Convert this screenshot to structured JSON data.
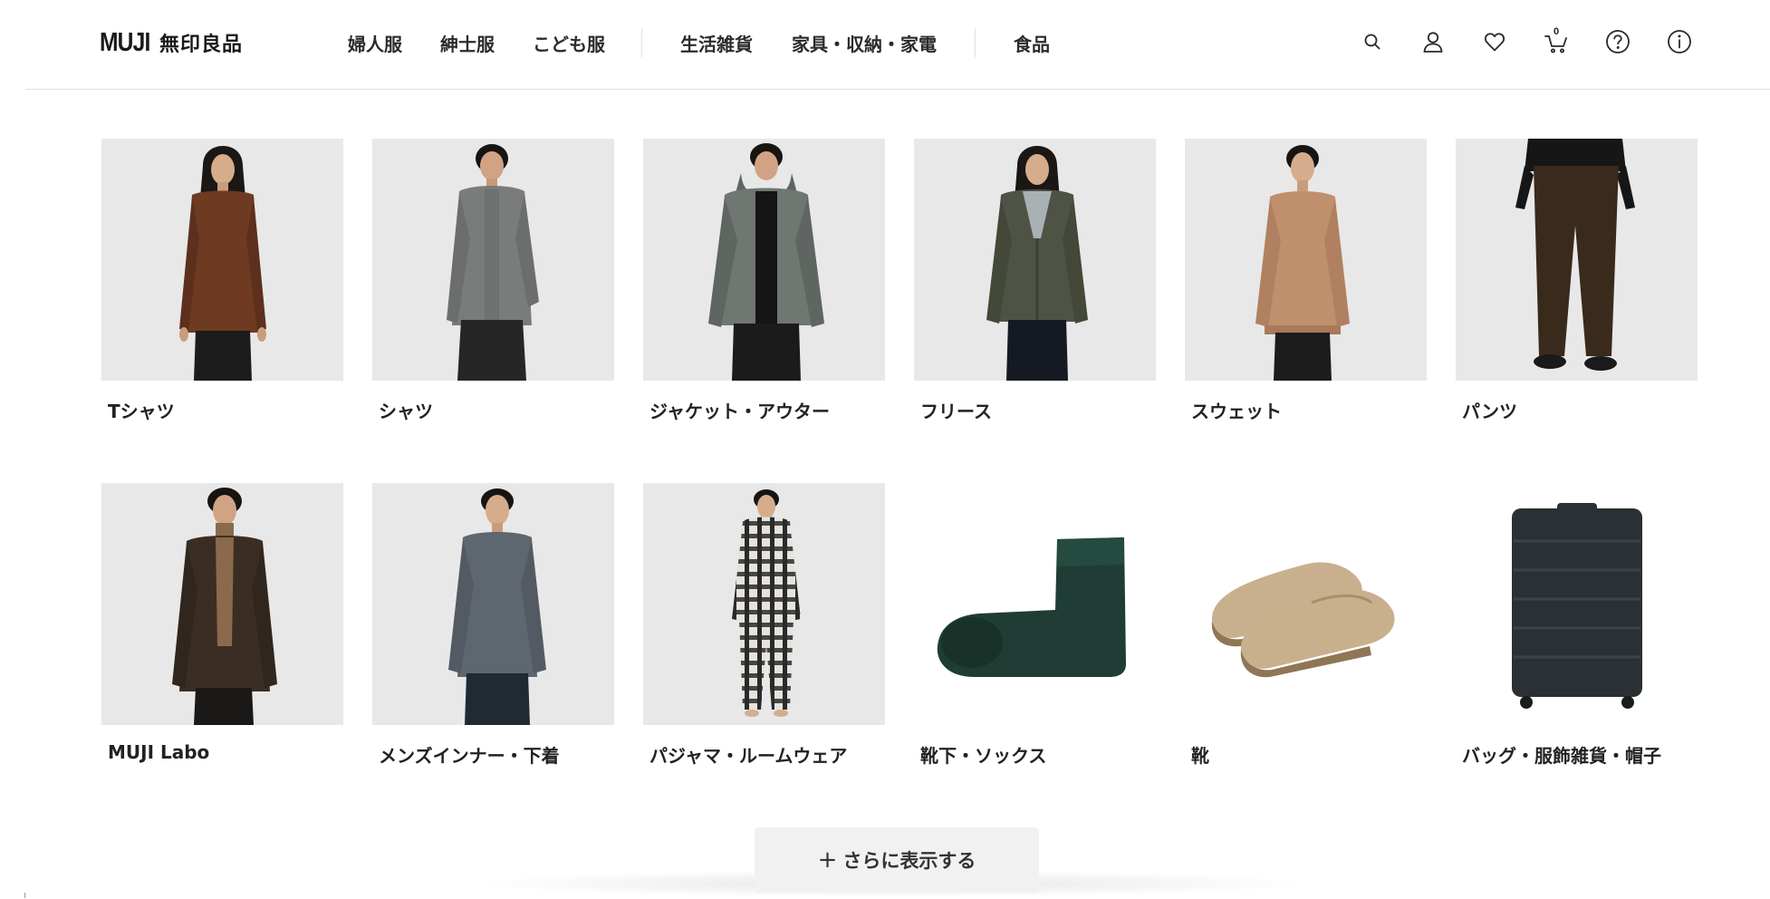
{
  "header": {
    "logo_latin": "MUJI",
    "logo_kanji": "無印良品",
    "nav": [
      {
        "label": "婦人服"
      },
      {
        "label": "紳士服"
      },
      {
        "label": "こども服"
      },
      {
        "label": "生活雑貨"
      },
      {
        "label": "家具・収納・家電"
      },
      {
        "label": "食品"
      }
    ],
    "icons": {
      "search": "search-icon",
      "account": "user-icon",
      "favorites": "heart-icon",
      "cart": "cart-icon",
      "help": "question-circle-icon",
      "info": "info-circle-icon"
    },
    "cart_count": "0"
  },
  "categories": [
    {
      "label": "Tシャツ",
      "image": "model-wearing-brown-long-sleeve-tshirt"
    },
    {
      "label": "シャツ",
      "image": "model-wearing-gray-shirt"
    },
    {
      "label": "ジャケット・アウター",
      "image": "model-wearing-gray-hooded-jacket"
    },
    {
      "label": "フリース",
      "image": "model-wearing-olive-fleece"
    },
    {
      "label": "スウェット",
      "image": "model-wearing-beige-sweatshirt"
    },
    {
      "label": "パンツ",
      "image": "model-wearing-brown-trousers"
    },
    {
      "label": "MUJI Labo",
      "image": "model-wearing-brown-blazer"
    },
    {
      "label": "メンズインナー・下着",
      "image": "model-wearing-gray-long-sleeve-inner"
    },
    {
      "label": "パジャマ・ルームウェア",
      "image": "model-wearing-plaid-pajamas"
    },
    {
      "label": "靴下・ソックス",
      "image": "green-sock"
    },
    {
      "label": "靴",
      "image": "beige-padded-slip-on-shoes"
    },
    {
      "label": "バッグ・服飾雑貨・帽子",
      "image": "dark-suitcase"
    }
  ],
  "show_more": {
    "plus": "+",
    "label": "さらに表示する"
  },
  "colors": {
    "page_bg": "#ffffff",
    "thumb_bg": "#e7e7e7",
    "button_bg": "#f1f1f1",
    "text": "#222222",
    "divider": "#e1e1e1"
  }
}
